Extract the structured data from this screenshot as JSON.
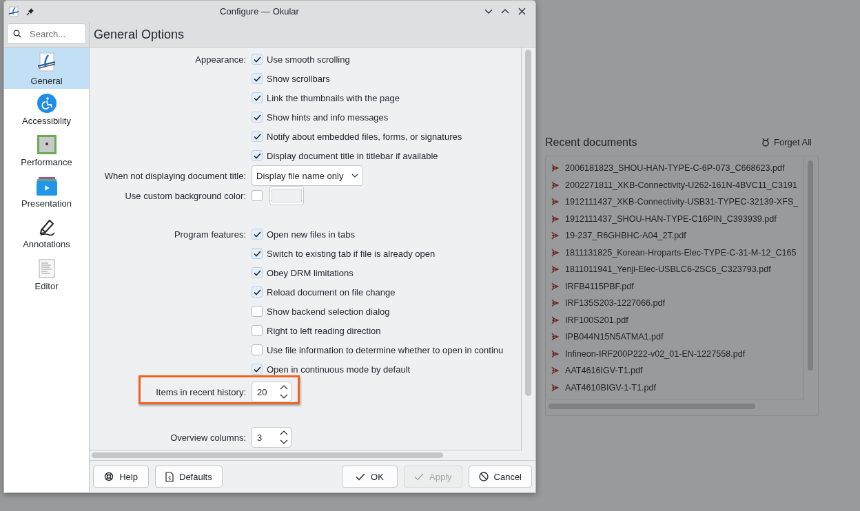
{
  "window": {
    "title": "Configure — Okular"
  },
  "search": {
    "placeholder": "Search..."
  },
  "page_title": "General Options",
  "sidebar": {
    "items": [
      {
        "label": "General",
        "selected": true
      },
      {
        "label": "Accessibility",
        "selected": false
      },
      {
        "label": "Performance",
        "selected": false
      },
      {
        "label": "Presentation",
        "selected": false
      },
      {
        "label": "Annotations",
        "selected": false
      },
      {
        "label": "Editor",
        "selected": false
      }
    ]
  },
  "sections": [
    {
      "rows": [
        {
          "kind": "checkbox",
          "label": "Appearance:",
          "text": "Use smooth scrolling",
          "checked": true
        },
        {
          "kind": "checkbox",
          "text": "Show scrollbars",
          "checked": true
        },
        {
          "kind": "checkbox",
          "text": "Link the thumbnails with the page",
          "checked": true
        },
        {
          "kind": "checkbox",
          "text": "Show hints and info messages",
          "checked": true
        },
        {
          "kind": "checkbox",
          "text": "Notify about embedded files, forms, or signatures",
          "checked": true
        },
        {
          "kind": "checkbox",
          "text": "Display document title in titlebar if available",
          "checked": true
        },
        {
          "kind": "combo",
          "label": "When not displaying document title:",
          "value": "Display file name only"
        },
        {
          "kind": "color",
          "label": "Use custom background color:",
          "checked": false
        }
      ]
    },
    {
      "rows": [
        {
          "kind": "checkbox",
          "label": "Program features:",
          "text": "Open new files in tabs",
          "checked": true
        },
        {
          "kind": "checkbox",
          "text": "Switch to existing tab if file is already open",
          "checked": true
        },
        {
          "kind": "checkbox",
          "text": "Obey DRM limitations",
          "checked": true
        },
        {
          "kind": "checkbox",
          "text": "Reload document on file change",
          "checked": true
        },
        {
          "kind": "checkbox",
          "text": "Show backend selection dialog",
          "checked": false
        },
        {
          "kind": "checkbox",
          "text": "Right to left reading direction",
          "checked": false
        },
        {
          "kind": "checkbox",
          "text": "Use file information to determine whether to open in continu",
          "checked": false
        },
        {
          "kind": "checkbox",
          "text": "Open in continuous mode by default",
          "checked": true
        },
        {
          "kind": "spin",
          "label": "Items in recent history:",
          "value": "20",
          "highlighted": true
        }
      ]
    },
    {
      "rows": [
        {
          "kind": "spin",
          "label": "Overview columns:",
          "value": "3",
          "highlighted": false
        }
      ]
    }
  ],
  "footer": {
    "left_buttons": [
      {
        "label": "Help",
        "disabled": false
      },
      {
        "label": "Defaults",
        "disabled": false
      }
    ],
    "right_buttons": [
      {
        "label": "OK",
        "disabled": false
      },
      {
        "label": "Apply",
        "disabled": true
      },
      {
        "label": "Cancel",
        "disabled": false
      }
    ]
  },
  "recent_documents": {
    "title": "Recent documents",
    "forget_all": "Forget All",
    "files": [
      "2006181823_SHOU-HAN-TYPE-C-6P-073_C668623.pdf",
      "2002271811_XKB-Connectivity-U262-161N-4BVC11_C3191",
      "1912111437_XKB-Connectivity-USB31-TYPEC-32139-XFS_",
      "1912111437_SHOU-HAN-TYPE-C16PIN_C393939.pdf",
      "19-237_R6GHBHC-A04_2T.pdf",
      "1811131825_Korean-Hroparts-Elec-TYPE-C-31-M-12_C165",
      "1811011941_Yenji-Elec-USBLC6-2SC6_C323793.pdf",
      "IRFB4115PBF.pdf",
      "IRF135S203-1227066.pdf",
      "IRF100S201.pdf",
      "IPB044N15N5ATMA1.pdf",
      "Infineon-IRF200P222-v02_01-EN-1227558.pdf",
      "AAT4616IGV-T1.pdf",
      "AAT4610BIGV-1-T1.pdf"
    ]
  }
}
